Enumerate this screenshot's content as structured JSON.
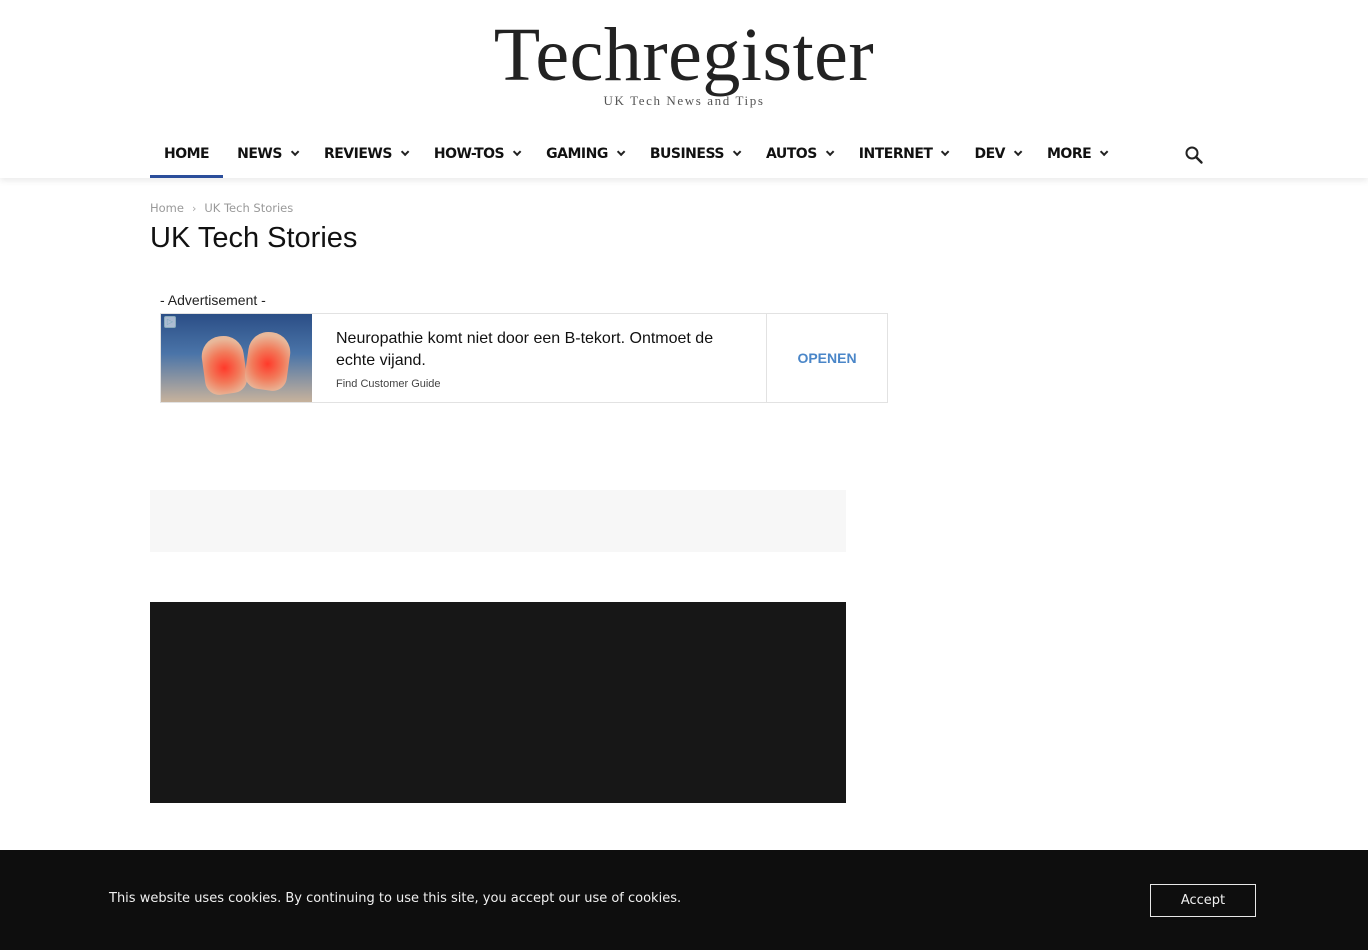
{
  "site": {
    "logo": "Techregister",
    "tagline": "UK Tech News and Tips"
  },
  "nav": {
    "items": [
      {
        "label": "HOME",
        "active": true,
        "dropdown": false
      },
      {
        "label": "NEWS",
        "dropdown": true
      },
      {
        "label": "REVIEWS",
        "dropdown": true
      },
      {
        "label": "HOW-TOS",
        "dropdown": true
      },
      {
        "label": "GAMING",
        "dropdown": true
      },
      {
        "label": "BUSINESS",
        "dropdown": true
      },
      {
        "label": "AUTOS",
        "dropdown": true
      },
      {
        "label": "INTERNET",
        "dropdown": true
      },
      {
        "label": "DEV",
        "dropdown": true
      },
      {
        "label": "MORE",
        "dropdown": true
      }
    ],
    "search_icon": "search-icon",
    "active_color": "#2b4e9b"
  },
  "breadcrumb": {
    "home": "Home",
    "separator": "›",
    "current": "UK Tech Stories"
  },
  "page": {
    "title": "UK Tech Stories"
  },
  "ad": {
    "label": "- Advertisement -",
    "headline": "Neuropathie komt niet door een B-tekort. Ontmoet de echte vijand.",
    "source": "Find Customer Guide",
    "cta": "OPENEN",
    "cta_color": "#4a86c8"
  },
  "cookie": {
    "text": "This website uses cookies. By continuing to use this site, you accept our use of cookies.",
    "accept": "Accept"
  }
}
